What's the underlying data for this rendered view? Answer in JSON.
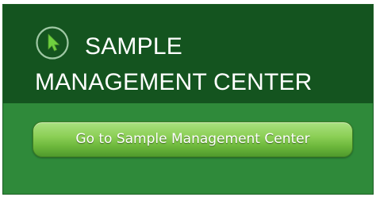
{
  "header": {
    "icon": "cursor-arrow-icon",
    "title": "SAMPLE MANAGEMENT CENTER"
  },
  "actions": {
    "go_label": "Go to Sample Management Center"
  },
  "colors": {
    "header_bg": "#14541f",
    "panel_bg": "#2f8a3a",
    "button_gradient_top": "#a9e080",
    "button_gradient_bottom": "#4f9a2c"
  }
}
